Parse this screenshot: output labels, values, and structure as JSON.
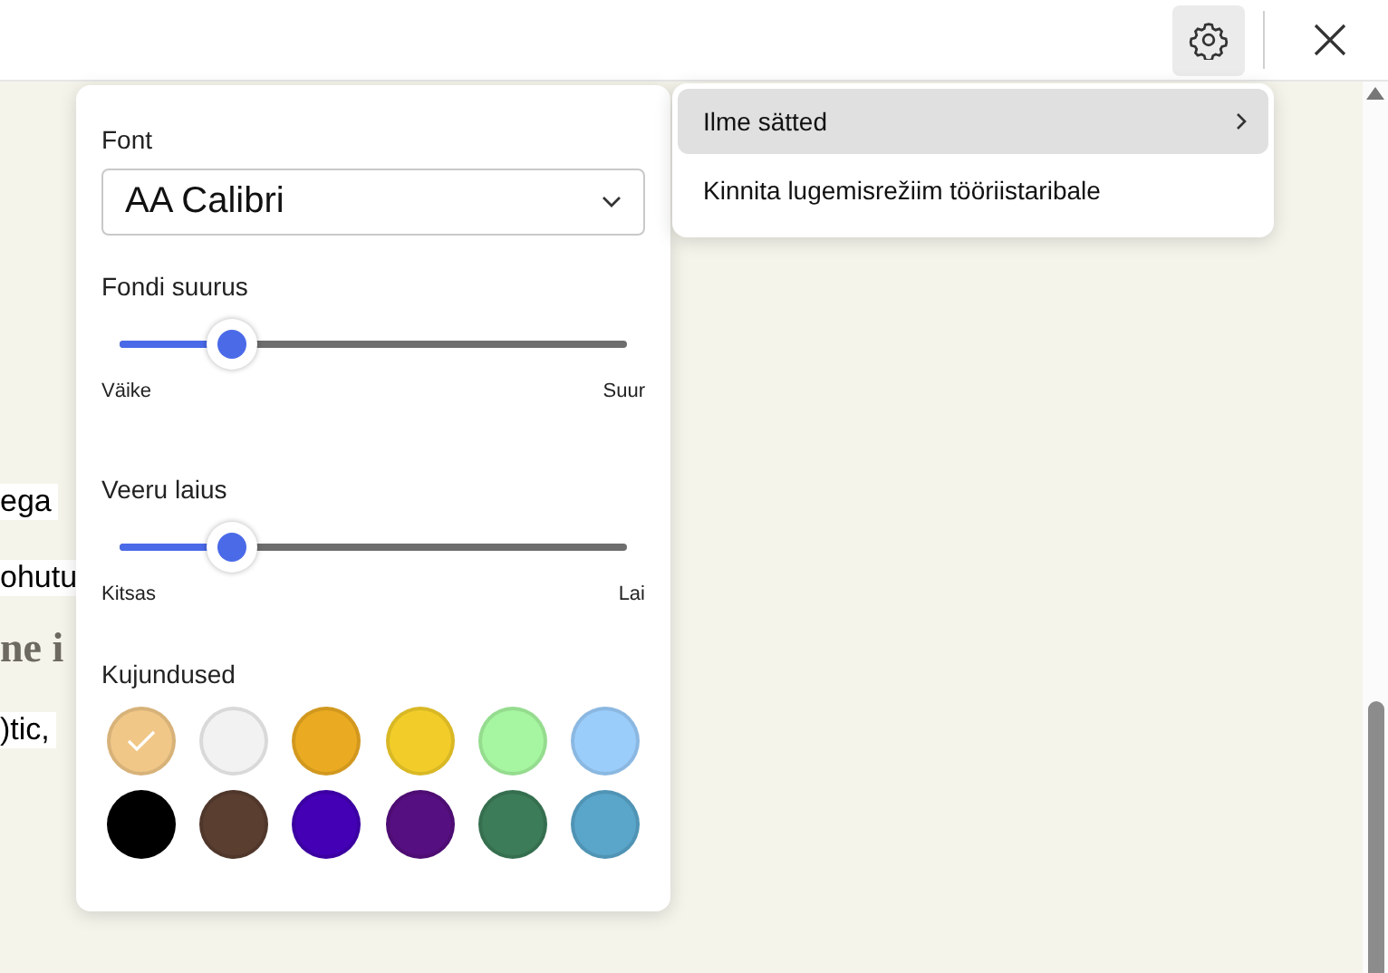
{
  "toolbar": {
    "settings_selected": true
  },
  "document_fragments": [
    {
      "kind": "plain",
      "text": "ega"
    },
    {
      "kind": "plain",
      "text": "ohutu"
    },
    {
      "kind": "serif",
      "text": "ne i"
    },
    {
      "kind": "plain",
      "text": ")tic,"
    }
  ],
  "settings_panel": {
    "font": {
      "label": "Font",
      "value": "AA Calibri"
    },
    "sliders": [
      {
        "label": "Fondi suurus",
        "level": 0.22,
        "min_label": "Väike",
        "max_label": "Suur"
      },
      {
        "label": "Veeru laius",
        "level": 0.22,
        "min_label": "Kitsas",
        "max_label": "Lai"
      }
    ],
    "themes": {
      "label": "Kujundused",
      "swatches": [
        {
          "color": "#f0c787",
          "selected": true
        },
        {
          "color": "#f2f2f2",
          "selected": false
        },
        {
          "color": "#eaaa22",
          "selected": false
        },
        {
          "color": "#f2cd2a",
          "selected": false
        },
        {
          "color": "#a6f5a0",
          "selected": false
        },
        {
          "color": "#9bcdfb",
          "selected": false
        },
        {
          "color": "#000000",
          "selected": false
        },
        {
          "color": "#5a3e30",
          "selected": false
        },
        {
          "color": "#4300b5",
          "selected": false
        },
        {
          "color": "#560f80",
          "selected": false
        },
        {
          "color": "#3c7c58",
          "selected": false
        },
        {
          "color": "#5aa5ca",
          "selected": false
        }
      ]
    }
  },
  "menu": {
    "items": [
      {
        "label": "Ilme sätted",
        "selected": true,
        "submenu": true
      },
      {
        "label": "Kinnita lugemisrežiim tööriistaribale",
        "selected": false,
        "submenu": false
      }
    ]
  }
}
